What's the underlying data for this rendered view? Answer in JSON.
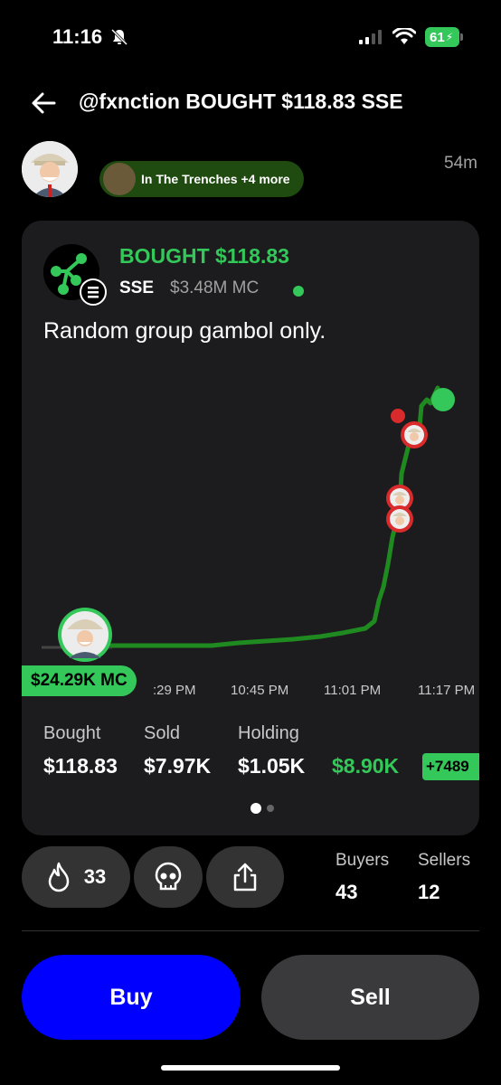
{
  "status_bar": {
    "time": "11:16",
    "battery": "61"
  },
  "header": {
    "title": "@fxnction BOUGHT $118.83 SSE",
    "age": "54m"
  },
  "group_chip": {
    "label": "In The Trenches +4 more"
  },
  "card": {
    "bought_line": "BOUGHT $118.83",
    "ticker": "SSE",
    "market_cap": "$3.48M MC",
    "note": "Random group gambol only.",
    "entry_mc_pill": "$24.29K MC",
    "x_labels": [
      ":29 PM",
      "10:45 PM",
      "11:01 PM",
      "11:17 PM"
    ],
    "stats": [
      {
        "label": "Bought",
        "value": "$118.83"
      },
      {
        "label": "Sold",
        "value": "$7.97K"
      },
      {
        "label": "Holding",
        "value": "$1.05K"
      },
      {
        "label": "",
        "value": "$8.90K"
      }
    ],
    "pct": "+7489",
    "page_dots": 2
  },
  "actions": {
    "fire_count": "33"
  },
  "market": {
    "buyers_label": "Buyers",
    "buyers": "43",
    "sellers_label": "Sellers",
    "sellers": "12"
  },
  "buttons": {
    "buy": "Buy",
    "sell": "Sell"
  },
  "colors": {
    "green": "#34c759",
    "buy_blue": "#0000ff",
    "card_bg": "#1c1c1e"
  }
}
